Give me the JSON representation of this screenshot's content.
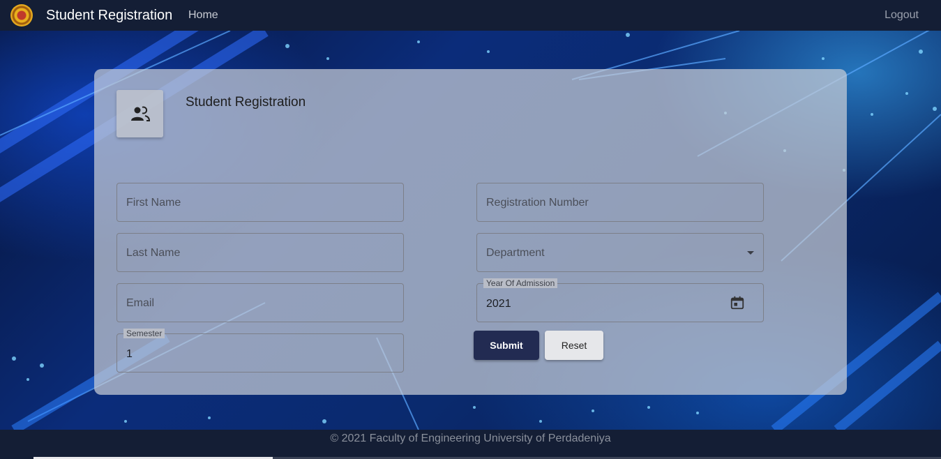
{
  "navbar": {
    "brand": "Student Registration",
    "home": "Home",
    "logout": "Logout",
    "logo_icon": "university-crest-icon"
  },
  "card": {
    "title": "Student Registration",
    "icon": "people-icon",
    "fields": {
      "first_name_placeholder": "First Name",
      "last_name_placeholder": "Last Name",
      "email_placeholder": "Email",
      "semester_label": "Semester",
      "semester_value": "1",
      "registration_number_placeholder": "Registration Number",
      "department_placeholder": "Department",
      "year_label": "Year Of Admission",
      "year_value": "2021"
    },
    "buttons": {
      "submit": "Submit",
      "reset": "Reset"
    }
  },
  "footer": {
    "text": "© 2021 Faculty of Engineering University of Perdadeniya"
  },
  "colors": {
    "navbar": "#141e35",
    "submit": "#222b52",
    "reset": "#e6e7ea"
  }
}
